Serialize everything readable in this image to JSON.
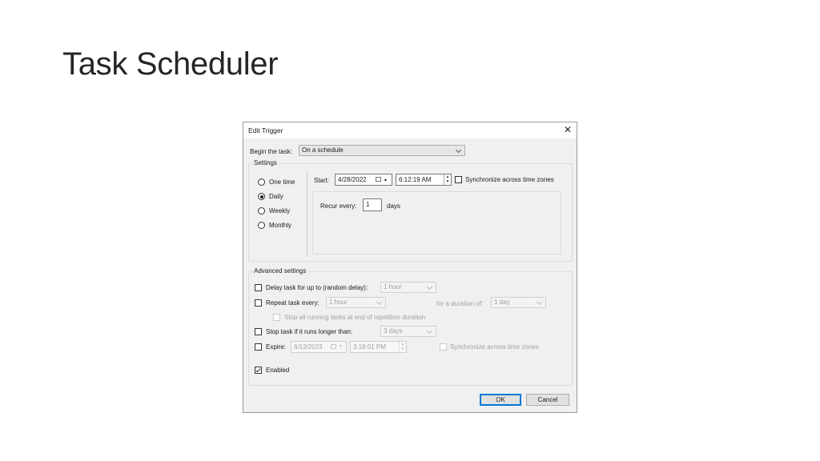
{
  "slide": {
    "title": "Task Scheduler"
  },
  "dialog": {
    "title": "Edit Trigger",
    "close_icon": "close-icon",
    "begin_task": {
      "label": "Begin the task:",
      "value": "On a schedule"
    },
    "settings": {
      "legend": "Settings",
      "schedule_options": [
        {
          "label": "One time",
          "selected": false
        },
        {
          "label": "Daily",
          "selected": true
        },
        {
          "label": "Weekly",
          "selected": false
        },
        {
          "label": "Monthly",
          "selected": false
        }
      ],
      "start_label": "Start:",
      "start_date": "4/28/2022",
      "start_time": "6:12:19 AM",
      "sync_time_zones": {
        "label": "Synchronize across time zones",
        "checked": false
      },
      "recur_label": "Recur every:",
      "recur_value": "1",
      "recur_unit": "days"
    },
    "advanced": {
      "legend": "Advanced settings",
      "delay": {
        "label": "Delay task for up to (random delay):",
        "value": "1 hour",
        "checked": false
      },
      "repeat": {
        "label": "Repeat task every:",
        "value": "1 hour",
        "checked": false,
        "duration_label": "for a duration of:",
        "duration_value": "1 day"
      },
      "stop_running": {
        "label": "Stop all running tasks at end of repetition duration",
        "checked": false
      },
      "stop_longer": {
        "label": "Stop task if it runs longer than:",
        "value": "3 days",
        "checked": false
      },
      "expire": {
        "label": "Expire:",
        "date": "6/13/2023",
        "time": "3:18:01 PM",
        "checked": false,
        "sync_label": "Synchronize across time zones"
      },
      "enabled": {
        "label": "Enabled",
        "checked": true
      }
    },
    "buttons": {
      "ok": "OK",
      "cancel": "Cancel"
    }
  }
}
